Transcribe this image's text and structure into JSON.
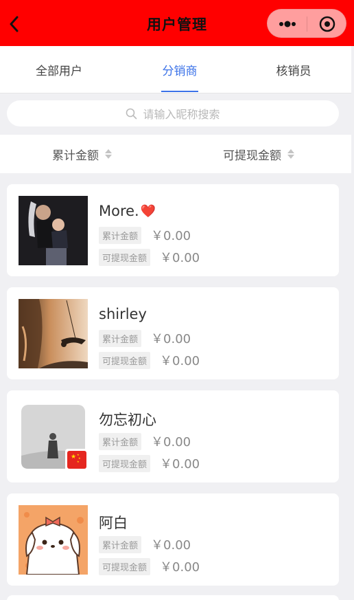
{
  "nav": {
    "title": "用户管理"
  },
  "tabs": [
    {
      "label": "全部用户"
    },
    {
      "label": "分销商"
    },
    {
      "label": "核销员"
    }
  ],
  "active_tab_index": 1,
  "search": {
    "placeholder": "请输入昵称搜索"
  },
  "sort": [
    {
      "label": "累计金额"
    },
    {
      "label": "可提现金额"
    }
  ],
  "users": [
    {
      "name": "More.",
      "emoji": "❤️",
      "total_label": "累计金额",
      "total": "￥0.00",
      "withdraw_label": "可提现金额",
      "withdraw": "￥0.00"
    },
    {
      "name": "shirley",
      "total_label": "累计金额",
      "total": "￥0.00",
      "withdraw_label": "可提现金额",
      "withdraw": "￥0.00"
    },
    {
      "name": "勿忘初心",
      "total_label": "累计金额",
      "total": "￥0.00",
      "withdraw_label": "可提现金额",
      "withdraw": "￥0.00"
    },
    {
      "name": "阿白",
      "total_label": "累计金额",
      "total": "￥0.00",
      "withdraw_label": "可提现金额",
      "withdraw": "￥0.00"
    }
  ],
  "colors": {
    "navbar": "#ff0000",
    "accent": "#3b72e8"
  }
}
